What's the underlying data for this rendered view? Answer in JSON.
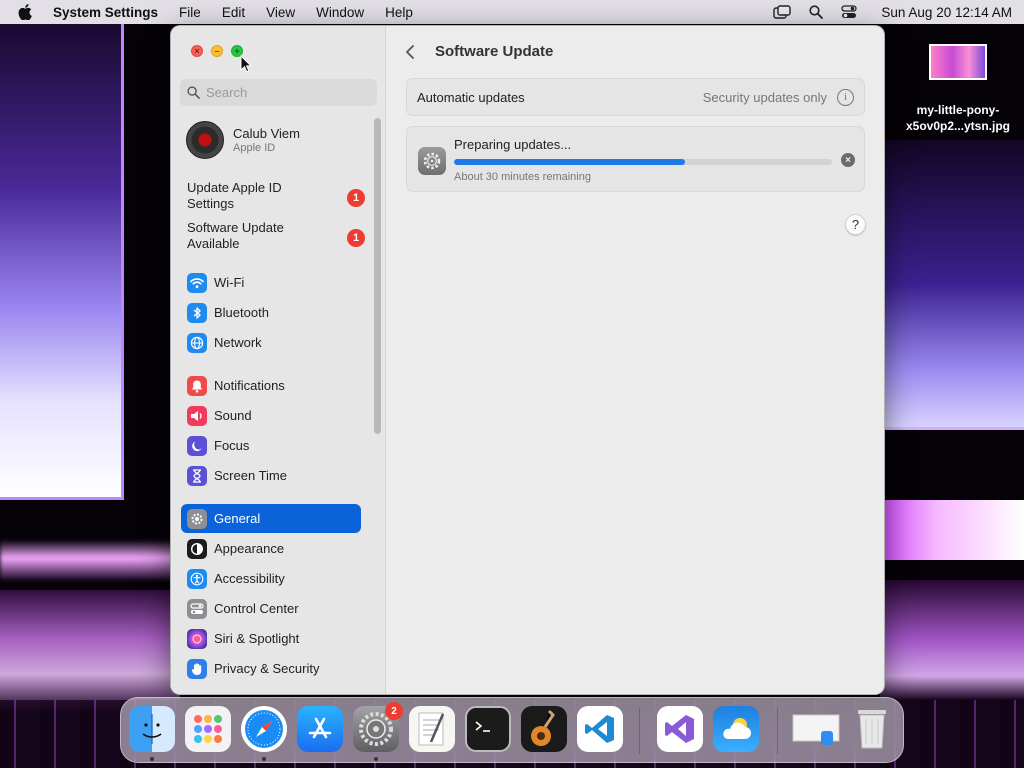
{
  "menubar": {
    "app_name": "System Settings",
    "items": [
      "File",
      "Edit",
      "View",
      "Window",
      "Help"
    ],
    "clock": "Sun Aug 20  12:14 AM"
  },
  "desktop_file": {
    "name_line1": "my-little-pony-",
    "name_line2": "x5ov0p2...ytsn.jpg"
  },
  "sidebar": {
    "search_placeholder": "Search",
    "account": {
      "name": "Calub Viem",
      "subtitle": "Apple ID"
    },
    "alerts": [
      {
        "label": "Update Apple ID Settings",
        "count": "1"
      },
      {
        "label": "Software Update Available",
        "count": "1"
      }
    ],
    "items": [
      {
        "label": "Wi-Fi",
        "icon": "wifi-icon",
        "color": "#1e8bf0"
      },
      {
        "label": "Bluetooth",
        "icon": "bluetooth-icon",
        "color": "#1e8bf0"
      },
      {
        "label": "Network",
        "icon": "globe-icon",
        "color": "#1e8bf0"
      },
      {
        "label": "Notifications",
        "icon": "bell-icon",
        "color": "#f04a4a"
      },
      {
        "label": "Sound",
        "icon": "speaker-icon",
        "color": "#ef3b5d"
      },
      {
        "label": "Focus",
        "icon": "moon-icon",
        "color": "#5b50d6"
      },
      {
        "label": "Screen Time",
        "icon": "hourglass-icon",
        "color": "#5b50d6"
      },
      {
        "label": "General",
        "icon": "gear-icon",
        "color": "#8e8e93"
      },
      {
        "label": "Appearance",
        "icon": "appearance-icon",
        "color": "#1c1c1e"
      },
      {
        "label": "Accessibility",
        "icon": "accessibility-icon",
        "color": "#1e8bf0"
      },
      {
        "label": "Control Center",
        "icon": "control-center-icon",
        "color": "#8e8e93"
      },
      {
        "label": "Siri & Spotlight",
        "icon": "siri-icon",
        "color": "#b04ad8"
      },
      {
        "label": "Privacy & Security",
        "icon": "hand-icon",
        "color": "#2f7fe8"
      }
    ],
    "selected": "General"
  },
  "content": {
    "title": "Software Update",
    "automatic_updates": {
      "label": "Automatic updates",
      "value": "Security updates only"
    },
    "update": {
      "title": "Preparing updates...",
      "subtitle": "About 30 minutes remaining",
      "progress": 0.61
    },
    "help_label": "?"
  },
  "dock": {
    "apps": [
      "Finder",
      "Launchpad",
      "Safari",
      "App Store",
      "System Settings",
      "TextEdit",
      "Terminal",
      "GarageBand",
      "Visual Studio Code",
      "Visual Studio",
      "Weather",
      "Preview",
      "Trash"
    ],
    "system_settings_badge": "2"
  }
}
